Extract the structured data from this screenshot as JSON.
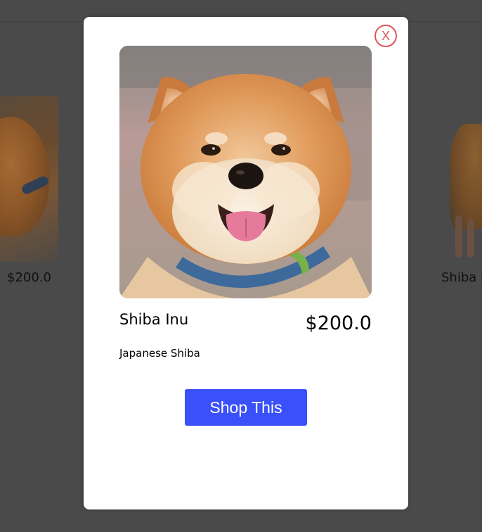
{
  "background": {
    "left_card_price": "$200.0",
    "right_card_name": "Shiba I"
  },
  "modal": {
    "close_label": "X",
    "image_icon": "shiba-inu-photo",
    "product_name": "Shiba Inu",
    "price": "$200.0",
    "description": "Japanese Shiba",
    "shop_button_label": "Shop This"
  },
  "colors": {
    "overlay": "#4a4a4a",
    "modal_bg": "#ffffff",
    "close_red": "#e05555",
    "button_blue": "#3a50fa"
  }
}
